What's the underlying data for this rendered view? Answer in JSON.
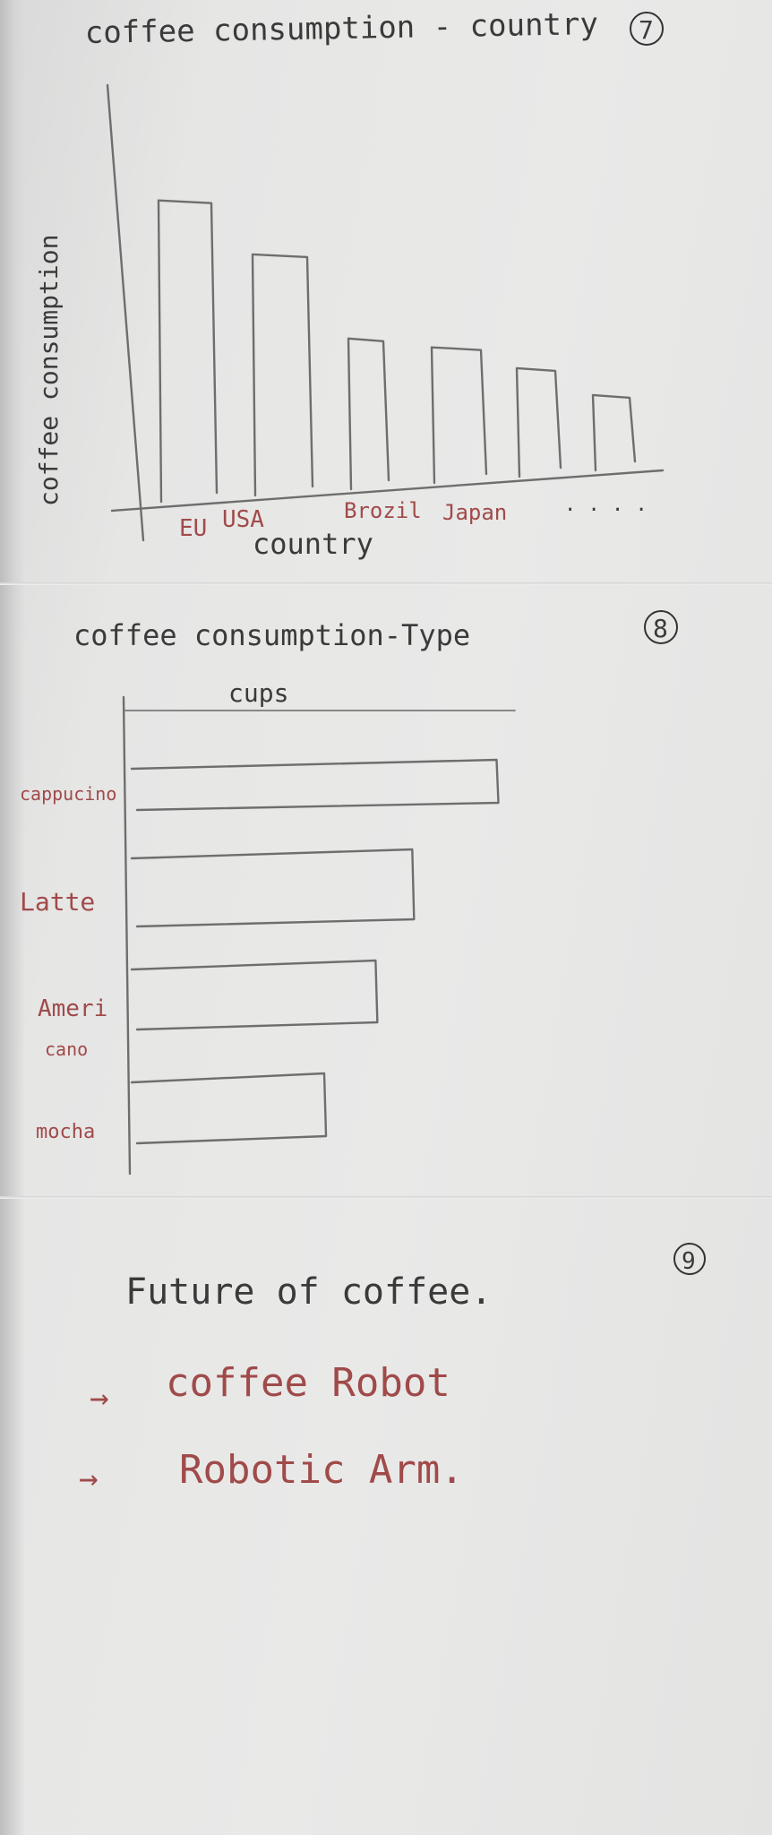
{
  "chart_data": [
    {
      "type": "bar",
      "title": "coffee consumption - country",
      "number": "7",
      "xlabel": "country",
      "ylabel": "coffee consumption",
      "categories": [
        "EU",
        "USA",
        "Brazil",
        "Japan",
        "",
        ""
      ],
      "category_labels_shown": [
        "EU",
        "USA",
        "Brozil",
        "Japan"
      ],
      "trailing_dots": ". . . .",
      "values": [
        10,
        8,
        5,
        4.5,
        3.6,
        2.5
      ],
      "ylim": [
        0,
        11
      ],
      "grid": false,
      "label_color": "#a04a4a"
    },
    {
      "type": "bar",
      "orientation": "horizontal",
      "title": "coffee consumption-Type",
      "number": "8",
      "xlabel": "cups",
      "categories": [
        "cappucino",
        "Latte",
        "Ameri cano",
        "mocha"
      ],
      "category_lines": [
        [
          "cappucino"
        ],
        [
          "Latte"
        ],
        [
          "Ameri",
          "cano"
        ],
        [
          "mocha"
        ]
      ],
      "values": [
        10,
        7.7,
        6.7,
        5.3
      ],
      "xlim": [
        0,
        12
      ],
      "grid": false
    }
  ],
  "future": {
    "number": "9",
    "title": "Future of coffee.",
    "items": [
      {
        "arrow": "→",
        "text": "coffee Robot"
      },
      {
        "arrow": "→",
        "text": "Robotic Arm."
      }
    ]
  }
}
